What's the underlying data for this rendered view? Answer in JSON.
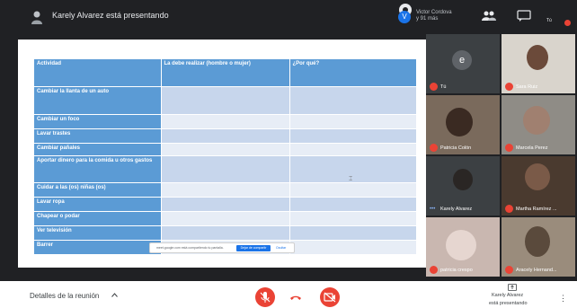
{
  "header": {
    "presenter_title": "Karely Alvarez está presentando",
    "viewer_initial": "V",
    "viewer_name": "Victor Cordova",
    "viewer_count": "y 91 más",
    "self_initial": "e",
    "self_label": "Tú"
  },
  "table": {
    "headers": [
      "Actividad",
      "La debe realizar (hombre o mujer)",
      "¿Por qué?"
    ],
    "rows": [
      "Cambiar la llanta de un auto",
      "Cambiar un foco",
      "Lavar trastes",
      "Cambiar pañales",
      "Aportar dinero para la comida u otros gastos",
      "Cuidar a las (os) niñas (os)",
      "Lavar ropa",
      "Chapear o podar",
      "Ver televisión",
      "Barrer"
    ]
  },
  "share_bar": {
    "text": "meet.google.com está compartiendo tu pantalla.",
    "stop_label": "Dejar de compartir",
    "hide_label": "Ocultar"
  },
  "participants": {
    "tu": "Tú",
    "tu_initial": "e",
    "sara": "Sara Ruiz",
    "patricia": "Patricia Colón",
    "marcela": "Marcela Perez",
    "karely": "Karely Alvarez",
    "martha": "Martha Ramírez ...",
    "patricia2": "patricia crespo",
    "aracely": "Aracely Hernand..."
  },
  "bottom": {
    "meeting_details": "Detalles de la reunión",
    "present_name": "Karely Alvarez",
    "present_sub": "está presentando"
  },
  "colors": {
    "header_blue": "#5b9bd5",
    "row_light": "#c7d6ec",
    "row_lighter": "#e7edf6",
    "alert_red": "#ea4335",
    "dark_bg": "#202124"
  }
}
